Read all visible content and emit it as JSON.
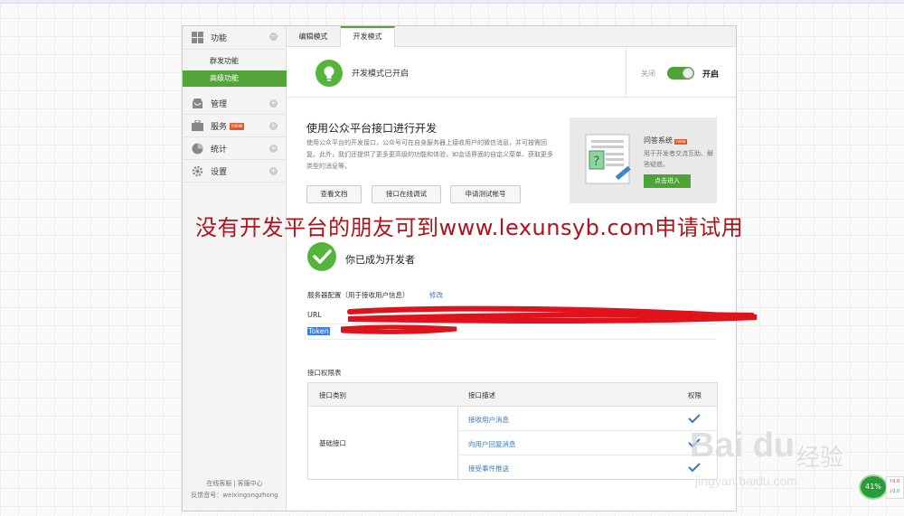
{
  "sidebar": {
    "groups": [
      {
        "label": "功能",
        "icon": "grid-icon"
      },
      {
        "label": "管理",
        "icon": "inbox-icon"
      },
      {
        "label": "服务",
        "icon": "briefcase-icon",
        "badge": "new"
      },
      {
        "label": "统计",
        "icon": "pie-chart-icon"
      },
      {
        "label": "设置",
        "icon": "gear-icon"
      }
    ],
    "sub_items": [
      {
        "label": "群发功能",
        "active": false
      },
      {
        "label": "高级功能",
        "active": true
      }
    ],
    "footer": {
      "link1": "在线客服",
      "separator": "|",
      "link2": "客服中心",
      "feedback": "反馈音号：weixingongzhong"
    }
  },
  "tabs": [
    {
      "label": "编辑模式",
      "active": false
    },
    {
      "label": "开发模式",
      "active": true
    }
  ],
  "devmode": {
    "status": "开发模式已开启",
    "switch_off_label": "关闭",
    "switch_on_label": "开启",
    "enabled": true
  },
  "intro": {
    "title": "使用公众平台接口进行开发",
    "description": "使用公众平台的开发接口，公众号可在自身服务器上接收用户的微信消息，并可按需回复。此外，我们还提供了更多更高级的功能和体验，如会话界面的自定义菜单、获取更多类型的消息等。",
    "buttons": [
      "查看文档",
      "接口在线调试",
      "申请测试帐号"
    ]
  },
  "promo": {
    "title": "问答系统",
    "badge": "new",
    "description": "用于开发者交流互助、解答疑惑。",
    "button": "点击进入"
  },
  "overlay_note": "没有开发平台的朋友可到www.lexunsyb.com申请试用",
  "developer": {
    "status": "你已成为开发者"
  },
  "server_config": {
    "title": "服务器配置（用于接收用户信息）",
    "edit_link": "修改",
    "url_label": "URL",
    "token_label": "Token"
  },
  "permissions": {
    "title": "接口权限表",
    "headers": [
      "接口类别",
      "接口描述",
      "权限"
    ],
    "category": "基础接口",
    "rows": [
      {
        "name": "接收用户消息",
        "granted": true
      },
      {
        "name": "向用户回复消息",
        "granted": true
      },
      {
        "name": "接受事件推送",
        "granted": true
      }
    ]
  },
  "watermark": {
    "brand": "Bai du",
    "product": "经验",
    "url": "jingyan.baidu.com"
  },
  "system_tray": {
    "gauge_value": "41%",
    "net_up": "0.0",
    "net_down": "0.0"
  },
  "colors": {
    "accent_green": "#52a639",
    "link_blue": "#3a78c3",
    "overlay_red": "#b0131a",
    "badge_red": "#e5572e"
  }
}
